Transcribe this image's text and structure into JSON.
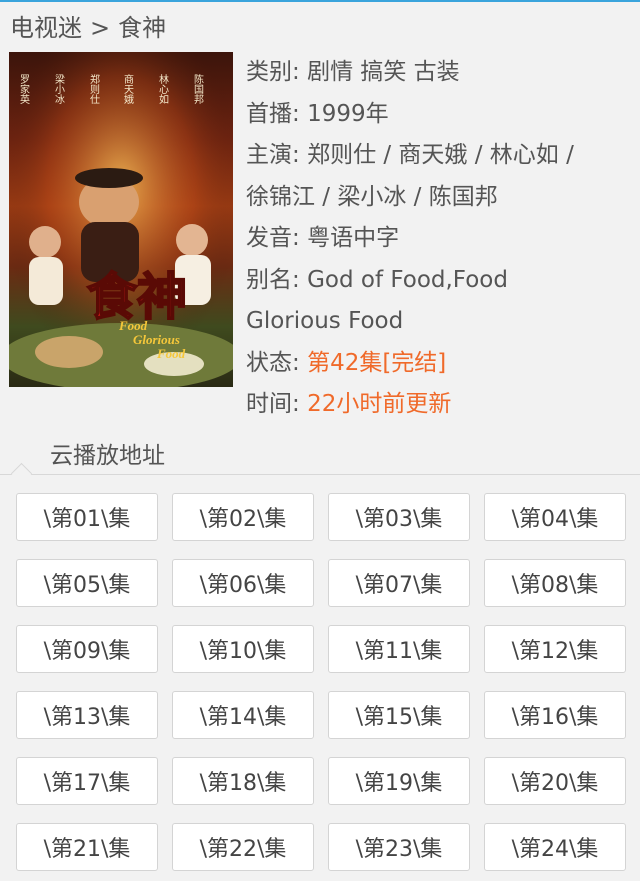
{
  "breadcrumb": {
    "home": "电视迷",
    "separator": ">",
    "current": "食神"
  },
  "poster": {
    "title_glyphs": "食神",
    "english_title": [
      "Food",
      "Glorious",
      "Food"
    ],
    "cast_names": [
      "罗家英",
      "梁小冰",
      "郑则仕",
      "商天娥",
      "林心如",
      "陈国邦"
    ]
  },
  "info": {
    "category_label": "类别:",
    "category_value": "剧情 搞笑 古装",
    "premiere_label": "首播:",
    "premiere_value": "1999年",
    "cast_label": "主演:",
    "cast_line1": "郑则仕 / 商天娥 / 林心如 /",
    "cast_line2": "徐锦江 / 梁小冰 / 陈国邦",
    "audio_label": "发音:",
    "audio_value": "粤语中字",
    "alias_label": "别名:",
    "alias_line1": "God of Food,Food",
    "alias_line2": "Glorious Food",
    "status_label": "状态:",
    "status_value": "第42集[完结]",
    "time_label": "时间:",
    "time_value": "22小时前更新"
  },
  "section": {
    "tab_label": "云播放地址"
  },
  "episodes": [
    "\\第01\\集",
    "\\第02\\集",
    "\\第03\\集",
    "\\第04\\集",
    "\\第05\\集",
    "\\第06\\集",
    "\\第07\\集",
    "\\第08\\集",
    "\\第09\\集",
    "\\第10\\集",
    "\\第11\\集",
    "\\第12\\集",
    "\\第13\\集",
    "\\第14\\集",
    "\\第15\\集",
    "\\第16\\集",
    "\\第17\\集",
    "\\第18\\集",
    "\\第19\\集",
    "\\第20\\集",
    "\\第21\\集",
    "\\第22\\集",
    "\\第23\\集",
    "\\第24\\集"
  ],
  "colors": {
    "accent": "#f06a2a",
    "text": "#555555",
    "top_line": "#3aa4dc",
    "poster_title": "#e8221b"
  }
}
